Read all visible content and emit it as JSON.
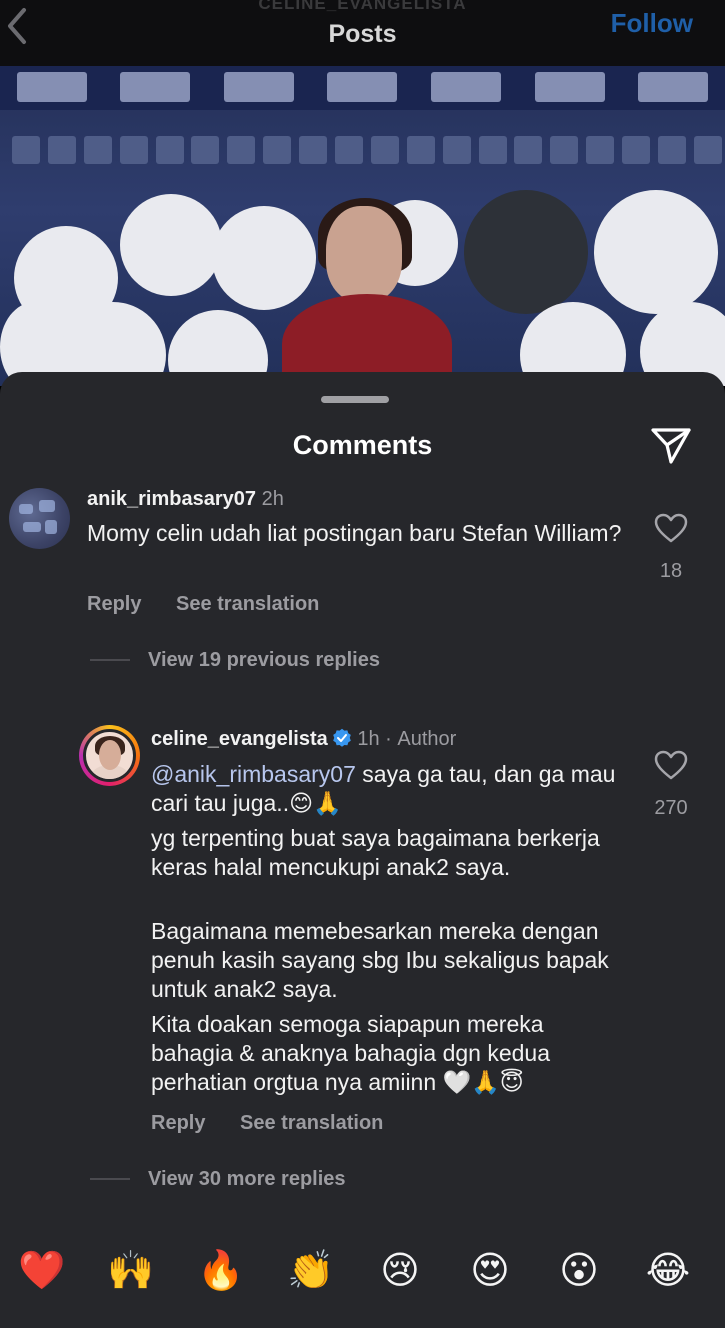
{
  "header": {
    "account_handle": "CELINE_EVANGELISTA",
    "title": "Posts",
    "follow_label": "Follow"
  },
  "comments_sheet": {
    "title": "Comments",
    "comments": [
      {
        "username": "anik_rimbasary07",
        "time": "2h",
        "text": "Momy celin udah liat postingan baru Stefan William?",
        "likes": "18",
        "reply_label": "Reply",
        "translate_label": "See translation"
      }
    ],
    "previous_replies_label": "View 19 previous replies",
    "reply": {
      "username": "celine_evangelista",
      "time": "1h",
      "author_badge": "Author",
      "mention": "@anik_rimbasary07",
      "paragraph1": " saya ga tau, dan ga mau cari tau juga..😊🙏",
      "paragraph2": "yg terpenting buat saya bagaimana berkerja keras halal mencukupi anak2 saya.",
      "paragraph3": "Bagaimana memebesarkan mereka dengan penuh kasih sayang sbg Ibu sekaligus bapak untuk anak2 saya.",
      "paragraph4": "Kita doakan semoga siapapun mereka bahagia & anaknya bahagia dgn kedua perhatian orgtua nya amiinn 🤍🙏😇",
      "likes": "270",
      "reply_label": "Reply",
      "translate_label": "See translation"
    },
    "more_replies_label": "View 30 more replies"
  },
  "emoji_bar": [
    "❤️",
    "🙌",
    "🔥",
    "👏",
    "😢",
    "😍",
    "😮",
    "😂"
  ],
  "icons": {
    "back": "chevron-left-icon",
    "share": "paper-plane-icon",
    "like": "heart-outline-icon",
    "verified": "verified-badge-icon"
  },
  "colors": {
    "sheet_background": "#26272b",
    "follow": "#1f5fa8",
    "mention": "#b8c7ee",
    "verified": "#3897f0"
  }
}
